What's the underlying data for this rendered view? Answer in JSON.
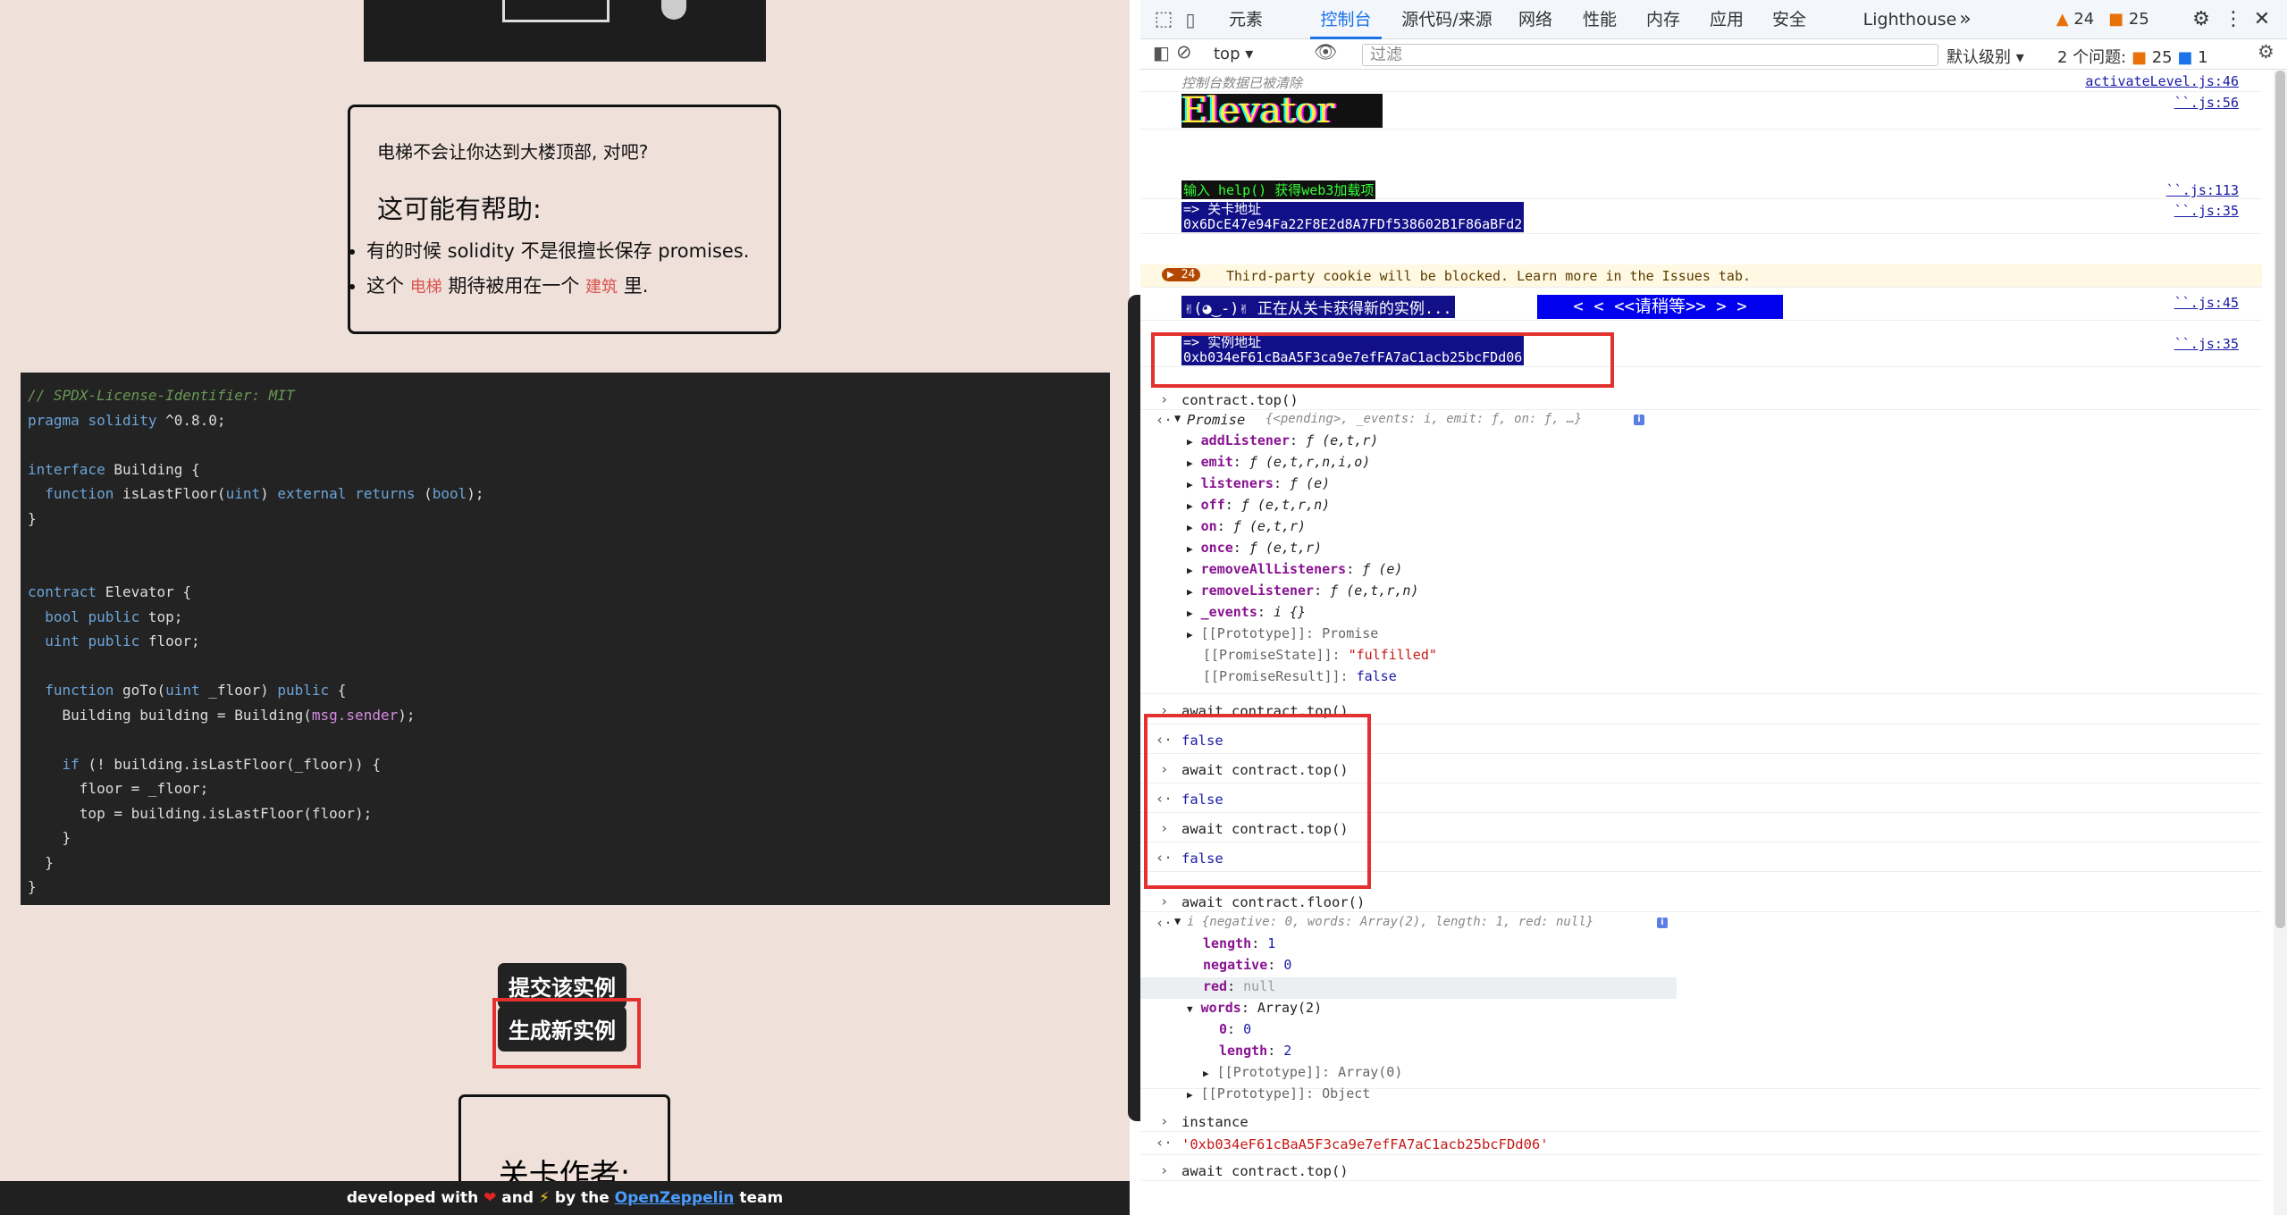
{
  "page": {
    "hint_question": "电梯不会让你达到大楼顶部, 对吧?",
    "hint_heading": "这可能有帮助:",
    "hint_items": [
      {
        "pre": "有的时候 solidity 不是很擅长保存 promises.",
        "kw1": "",
        "mid": "",
        "kw2": "",
        "post": ""
      },
      {
        "pre": "这个 ",
        "kw1": "电梯",
        "mid": " 期待被用在一个 ",
        "kw2": "建筑",
        "post": " 里."
      }
    ],
    "code_lines": [
      "// SPDX-License-Identifier: MIT",
      "pragma solidity ^0.8.0;",
      "",
      "interface Building {",
      "  function isLastFloor(uint) external returns (bool);",
      "}",
      "",
      "",
      "contract Elevator {",
      "  bool public top;",
      "  uint public floor;",
      "",
      "  function goTo(uint _floor) public {",
      "    Building building = Building(msg.sender);",
      "",
      "    if (! building.isLastFloor(_floor)) {",
      "      floor = _floor;",
      "      top = building.isLastFloor(floor);",
      "    }",
      "  }",
      "}"
    ],
    "submit_button": "提交该实例",
    "new_instance_button": "生成新实例",
    "author_label": "关卡作者:",
    "footer": {
      "pre": "developed with ",
      "mid": " and ",
      "mid2": " by the ",
      "link": "OpenZeppelin",
      "post": " team"
    }
  },
  "devtools": {
    "tabs": [
      "元素",
      "控制台",
      "源代码/来源",
      "网络",
      "性能",
      "内存",
      "应用",
      "安全",
      "Lighthouse"
    ],
    "active_tab": "控制台",
    "warn_count": "24",
    "error_count": "25",
    "context": "top",
    "filter_placeholder": "过滤",
    "level": "默认级别",
    "issues_label": "2 个问题:",
    "issues_err": "25",
    "issues_info": "1",
    "console": {
      "cleared": "控制台数据已被清除",
      "cleared_src": "activateLevel.js:46",
      "banner": "Elevator",
      "banner_src": "``.js:56",
      "help": "输入 help() 获得web3加载项",
      "help_src": "``.js:113",
      "level_addr_label": "=> 关卡地址",
      "level_addr": "0x6DcE47e94Fa22F8E2d8A7FDf538602B1F86aBFd2",
      "level_src": "``.js:35",
      "cookie_count": "24",
      "cookie_msg": "Third-party cookie will be blocked. Learn more in the Issues tab.",
      "fetching": "✌(◕‿-)✌ 正在从关卡获得新的实例...",
      "wait": "< < <<请稍等>> > >",
      "fetch_src": "``.js:45",
      "inst_addr_label": "=> 实例地址",
      "inst_addr": "0xb034eF61cBaA5F3ca9e7efFA7aC1acb25bcFDd06",
      "inst_src": "``.js:35",
      "cmd1": "contract.top()",
      "promise_head": "Promise",
      "promise_preview": "{<pending>, _events: i, emit: ƒ, on: ƒ, …}",
      "promise_props": [
        {
          "k": "addListener",
          "v": "ƒ (e,t,r)"
        },
        {
          "k": "emit",
          "v": "ƒ (e,t,r,n,i,o)"
        },
        {
          "k": "listeners",
          "v": "ƒ (e)"
        },
        {
          "k": "off",
          "v": "ƒ (e,t,r,n)"
        },
        {
          "k": "on",
          "v": "ƒ (e,t,r)"
        },
        {
          "k": "once",
          "v": "ƒ (e,t,r)"
        },
        {
          "k": "removeAllListeners",
          "v": "ƒ (e)"
        },
        {
          "k": "removeListener",
          "v": "ƒ (e,t,r,n)"
        },
        {
          "k": "_events",
          "v": "i  {}"
        }
      ],
      "proto": "[[Prototype]]: Promise",
      "pstate_k": "[[PromiseState]]: ",
      "pstate_v": "\"fulfilled\"",
      "presult_k": "[[PromiseResult]]: ",
      "presult_v": "false",
      "await_top": "await contract.top()",
      "false": "false",
      "await_floor": "await contract.floor()",
      "bn_preview": "i {negative: 0, words: Array(2), length: 1, red: null}",
      "bn_props": [
        {
          "k": "length",
          "v": "1"
        },
        {
          "k": "negative",
          "v": "0"
        },
        {
          "k": "red",
          "v": "null"
        },
        {
          "k": "words",
          "v": "Array(2)"
        },
        {
          "k": "0",
          "v": "0"
        },
        {
          "k": "length",
          "v": "2"
        }
      ],
      "arr_proto": "[[Prototype]]: Array(0)",
      "obj_proto": "[[Prototype]]: Object",
      "cmd_instance": "instance",
      "instance_val": "'0xb034eF61cBaA5F3ca9e7efFA7aC1acb25bcFDd06'",
      "last_cmd": "await contract.top()"
    }
  }
}
